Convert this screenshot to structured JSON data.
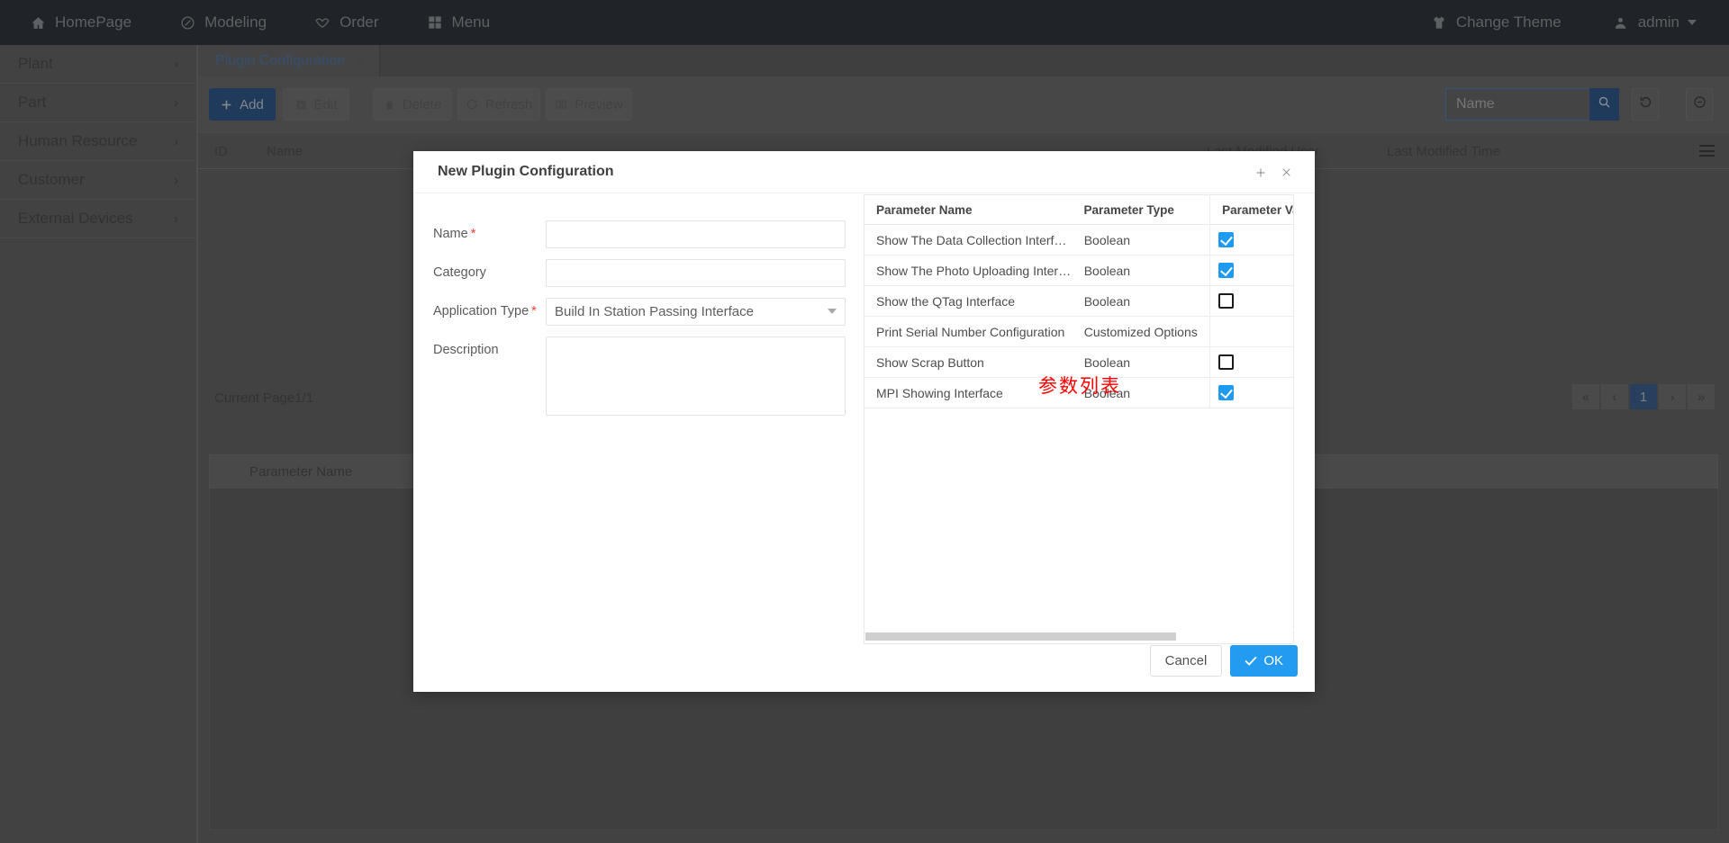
{
  "topnav": {
    "items": [
      {
        "label": "HomePage",
        "icon": "home-icon"
      },
      {
        "label": "Modeling",
        "icon": "pencil-circle-icon"
      },
      {
        "label": "Order",
        "icon": "handshake-icon"
      },
      {
        "label": "Menu",
        "icon": "grid-icon"
      }
    ],
    "right": {
      "theme_label": "Change Theme",
      "theme_icon": "tshirt-icon",
      "user_label": "admin",
      "user_icon": "user-icon"
    }
  },
  "sidebar": {
    "items": [
      {
        "label": "Plant"
      },
      {
        "label": "Part"
      },
      {
        "label": "Human Resource"
      },
      {
        "label": "Customer"
      },
      {
        "label": "External Devices"
      }
    ],
    "chevron": "›"
  },
  "tabs": [
    {
      "label": "Plugin Configuration",
      "close": "×",
      "active": true
    }
  ],
  "toolbar": {
    "buttons": [
      {
        "label": "Add",
        "icon": "plus-icon",
        "style": "primary",
        "disabled": false
      },
      {
        "label": "Edit",
        "icon": "pencil-square-icon",
        "style": "ghost",
        "disabled": true
      },
      {
        "label": "Delete",
        "icon": "trash-icon",
        "style": "ghost",
        "disabled": true
      },
      {
        "label": "Refresh",
        "icon": "refresh-icon",
        "style": "ghost",
        "disabled": true
      },
      {
        "label": "Preview",
        "icon": "book-icon",
        "style": "ghost",
        "disabled": true
      }
    ],
    "search": {
      "placeholder": "Name",
      "value": "",
      "search_icon": "search-icon"
    },
    "reset_icon": "reset-circle-icon",
    "collapse_icon": "minus-circle-icon"
  },
  "main_table": {
    "columns": [
      "ID",
      "Name",
      "Last Modified User",
      "Last Modified Time"
    ],
    "rows": [],
    "menu_icon": "hamburger-icon"
  },
  "pagination": {
    "current_page_label": "Current Page1/1",
    "first": "«",
    "prev": "‹",
    "page": "1",
    "next": "›",
    "last": "»"
  },
  "lower_panel": {
    "column_label": "Parameter Name"
  },
  "modal": {
    "title": "New Plugin Configuration",
    "add_icon": "plus-icon",
    "close_icon": "close-icon",
    "form": {
      "name": {
        "label": "Name",
        "required": true,
        "value": "",
        "placeholder": ""
      },
      "category": {
        "label": "Category",
        "required": false,
        "value": "",
        "placeholder": ""
      },
      "application_type": {
        "label": "Application Type",
        "required": true,
        "value": "Build In Station Passing Interface"
      },
      "description": {
        "label": "Description",
        "required": false,
        "value": "",
        "placeholder": ""
      }
    },
    "param_table": {
      "columns": [
        "Parameter Name",
        "Parameter Type",
        "Parameter Va"
      ],
      "rows": [
        {
          "name": "Show The Data Collection Interf…",
          "type": "Boolean",
          "value_kind": "checkbox",
          "checked": true
        },
        {
          "name": "Show The Photo Uploading Inter…",
          "type": "Boolean",
          "value_kind": "checkbox",
          "checked": true
        },
        {
          "name": "Show the QTag Interface",
          "type": "Boolean",
          "value_kind": "checkbox",
          "checked": false
        },
        {
          "name": "Print Serial Number Configuration",
          "type": "Customized Options",
          "value_kind": "none",
          "checked": false
        },
        {
          "name": "Show Scrap Button",
          "type": "Boolean",
          "value_kind": "checkbox",
          "checked": false
        },
        {
          "name": "MPI Showing Interface",
          "type": "Boolean",
          "value_kind": "checkbox",
          "checked": true
        }
      ],
      "annotation": "参数列表"
    },
    "footer": {
      "cancel_label": "Cancel",
      "ok_label": "OK",
      "ok_icon": "check-icon"
    }
  },
  "colors": {
    "topnav_bg": "#262a2e",
    "accent_blue": "#239bf0",
    "primary_dark_blue": "#25456b",
    "annotation_red": "#ff0000",
    "required_red": "#f04134"
  }
}
